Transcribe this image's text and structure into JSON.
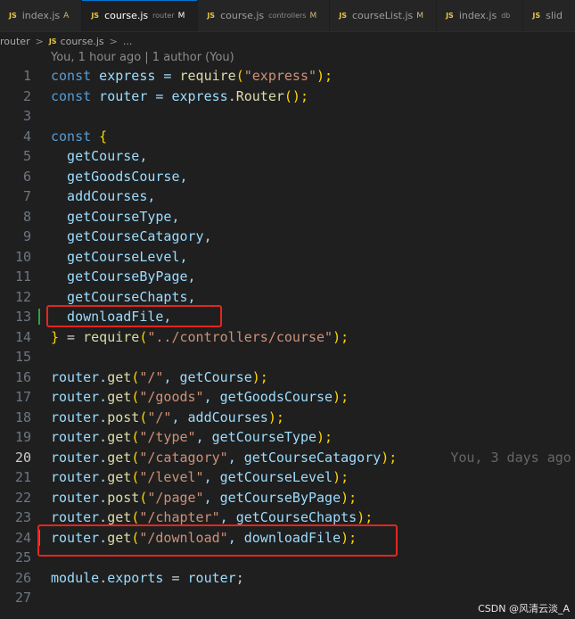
{
  "tabs": [
    {
      "name": "index.js",
      "desc": "",
      "status": "A",
      "active": false
    },
    {
      "name": "course.js",
      "desc": "router",
      "status": "M",
      "active": true
    },
    {
      "name": "course.js",
      "desc": "controllers",
      "status": "M",
      "active": false
    },
    {
      "name": "courseList.js",
      "desc": "",
      "status": "M",
      "active": false
    },
    {
      "name": "index.js",
      "desc": "db",
      "status": "",
      "active": false
    },
    {
      "name": "slid",
      "desc": "",
      "status": "",
      "active": false
    }
  ],
  "js_badge": "JS",
  "breadcrumb": {
    "folder": "router",
    "separator": ">",
    "file": "course.js",
    "more": "..."
  },
  "codelens": "You, 1 hour ago | 1 author (You)",
  "code": {
    "line1": {
      "n": "1",
      "t": [
        "const",
        " express = ",
        "require",
        "(",
        "\"express\"",
        ");"
      ]
    },
    "line2": {
      "n": "2",
      "t": [
        "const",
        " router = ",
        "express",
        ".",
        "Router",
        "();"
      ]
    },
    "line3": {
      "n": "3"
    },
    "line4": {
      "n": "4",
      "t": [
        "const",
        " {"
      ]
    },
    "line5": {
      "n": "5",
      "t": [
        "  getCourse,"
      ]
    },
    "line6": {
      "n": "6",
      "t": [
        "  getGoodsCourse,"
      ]
    },
    "line7": {
      "n": "7",
      "t": [
        "  addCourses,"
      ]
    },
    "line8": {
      "n": "8",
      "t": [
        "  getCourseType,"
      ]
    },
    "line9": {
      "n": "9",
      "t": [
        "  getCourseCatagory,"
      ]
    },
    "line10": {
      "n": "10",
      "t": [
        "  getCourseLevel,"
      ]
    },
    "line11": {
      "n": "11",
      "t": [
        "  getCourseByPage,"
      ]
    },
    "line12": {
      "n": "12",
      "t": [
        "  getCourseChapts,"
      ]
    },
    "line13": {
      "n": "13",
      "t": [
        "  downloadFile,"
      ]
    },
    "line14": {
      "n": "14",
      "t": [
        "}",
        " = ",
        "require",
        "(",
        "\"../controllers/course\"",
        ");"
      ]
    },
    "line15": {
      "n": "15"
    },
    "line16": {
      "n": "16",
      "t": [
        "router.",
        "get",
        "(",
        "\"/\"",
        ", getCourse",
        ");"
      ]
    },
    "line17": {
      "n": "17",
      "t": [
        "router.",
        "get",
        "(",
        "\"/goods\"",
        ", getGoodsCourse",
        ");"
      ]
    },
    "line18": {
      "n": "18",
      "t": [
        "router.",
        "post",
        "(",
        "\"/\"",
        ", addCourses",
        ");"
      ]
    },
    "line19": {
      "n": "19",
      "t": [
        "router.",
        "get",
        "(",
        "\"/type\"",
        ", getCourseType",
        ");"
      ]
    },
    "line20": {
      "n": "20",
      "t": [
        "router.",
        "get",
        "(",
        "\"/catagory\"",
        ", getCourseCatagory",
        ");"
      ],
      "blame": "You, 3 days ago"
    },
    "line21": {
      "n": "21",
      "t": [
        "router.",
        "get",
        "(",
        "\"/level\"",
        ", getCourseLevel",
        ");"
      ]
    },
    "line22": {
      "n": "22",
      "t": [
        "router.",
        "post",
        "(",
        "\"/page\"",
        ", getCourseByPage",
        ");"
      ]
    },
    "line23": {
      "n": "23",
      "t": [
        "router.",
        "get",
        "(",
        "\"/chapter\"",
        ", getCourseChapts",
        ");"
      ]
    },
    "line24": {
      "n": "24",
      "t": [
        "router.",
        "get",
        "(",
        "\"/download\"",
        ", downloadFile",
        ");"
      ]
    },
    "line25": {
      "n": "25"
    },
    "line26": {
      "n": "26",
      "t": [
        "module",
        ".",
        "exports",
        " = ",
        "router",
        ";"
      ]
    },
    "line27": {
      "n": "27"
    }
  },
  "watermark": "CSDN @风清云淡_A",
  "colors": {
    "highlight_box": "#e3261f",
    "accent": "#0078d4",
    "git_modified": "#2ea043"
  }
}
